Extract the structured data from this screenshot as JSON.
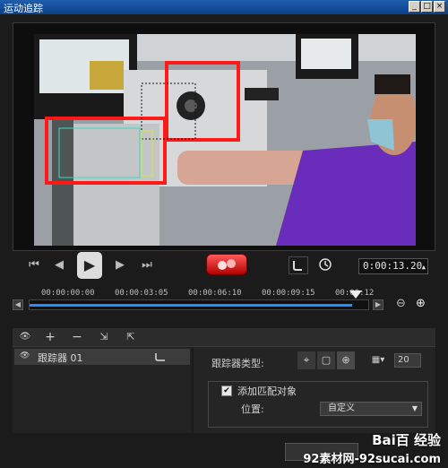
{
  "window": {
    "title": "运动追踪",
    "buttons": [
      "_",
      "□",
      "×"
    ]
  },
  "playback": {
    "timecode": "0:00:13.20"
  },
  "timeline": {
    "ticks": [
      "00:00:00:00",
      "00:00:03:05",
      "00:00:06:10",
      "00:00:09:15",
      "00:00:12"
    ]
  },
  "trackers": {
    "items": [
      {
        "label": "跟踪器 01"
      }
    ]
  },
  "properties": {
    "tracker_type_label": "跟踪器类型:",
    "spin_value": "20",
    "add_match_label": "添加匹配对象",
    "position_label": "位置:",
    "position_value": "自定义"
  },
  "watermark": {
    "text": "Bai百 经验",
    "sub": "92素材网-92sucai.com"
  },
  "colors": {
    "accent": "#1e90ff",
    "record": "#e00000",
    "highlight_box": "#ff1a1a"
  }
}
